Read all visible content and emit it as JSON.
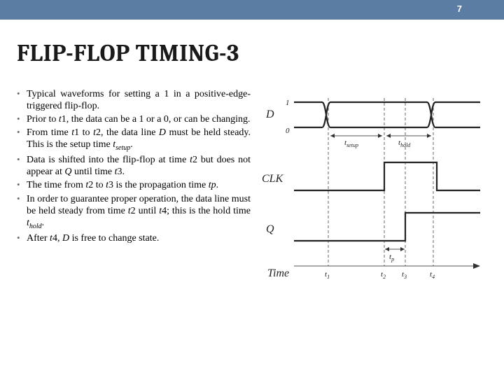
{
  "page_number": "7",
  "title": "FLIP-FLOP TIMING-3",
  "bullets": [
    {
      "pre": "Typical waveforms for setting a 1 in a positive-edge-triggered flip-flop."
    },
    {
      "pre": "Prior to ",
      "i1": "t",
      "post1": "1, the data can be a 1 or a 0, or can be changing."
    },
    {
      "pre": "From time ",
      "i1": "t",
      "mid1": "1 to ",
      "i2": "t",
      "mid2": "2, the data line ",
      "i3": "D",
      "mid3": " must be held steady. This is the setup time ",
      "i4": "t",
      "sub4": "setup",
      "post": "."
    },
    {
      "pre": "Data is shifted into the flip-flop at time ",
      "i1": "t",
      "mid1": "2 but does not appear at ",
      "i2": "Q",
      "mid2": " until time ",
      "i3": "t",
      "post": "3."
    },
    {
      "pre": "The time from ",
      "i1": "t",
      "mid1": "2 to ",
      "i2": "t",
      "mid2": "3 is the propagation time ",
      "i3": "tp",
      "post": "."
    },
    {
      "pre": "In order to guarantee proper operation, the data line must be held steady from time ",
      "i1": "t",
      "mid1": "2 until ",
      "i2": "t",
      "mid2": "4; this is the hold time ",
      "i3": "t",
      "sub3": "hold",
      "post": "."
    },
    {
      "pre": "After ",
      "i1": "t",
      "mid1": "4, ",
      "i2": "D",
      "post": " is free to change state."
    }
  ],
  "diagram": {
    "signals": {
      "d": "D",
      "clk": "CLK",
      "q": "Q"
    },
    "levels": {
      "one": "1",
      "zero": "0"
    },
    "times": {
      "t1": "t",
      "t1n": "1",
      "t2": "t",
      "t2n": "2",
      "t3": "t",
      "t3n": "3",
      "t4": "t",
      "t4n": "4"
    },
    "labels": {
      "tsetup": "t",
      "tsetup_sub": "setup",
      "thold": "t",
      "thold_sub": "hold",
      "tp": "t",
      "tp_sub": "p",
      "time": "Time"
    }
  }
}
